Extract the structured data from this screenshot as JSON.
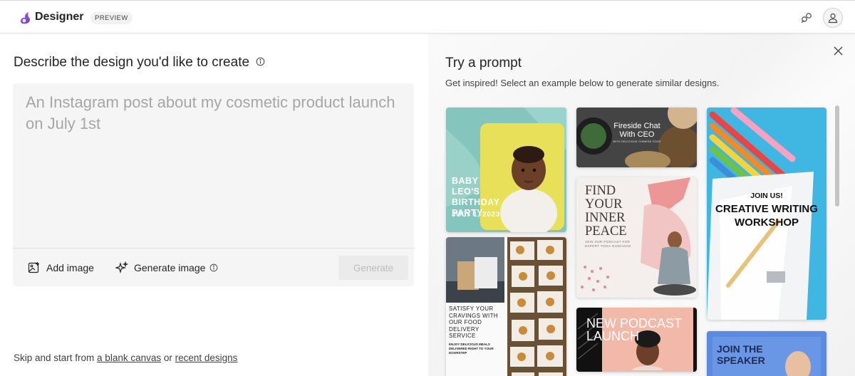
{
  "header": {
    "app_title": "Designer",
    "badge": "PREVIEW",
    "accent_color": "#8a4fd6"
  },
  "left": {
    "title": "Describe the design you'd like to create",
    "prompt_placeholder": "An Instagram post about my cosmetic product launch on July 1st",
    "add_image_label": "Add image",
    "generate_image_label": "Generate image",
    "generate_label": "Generate",
    "footer": {
      "prefix": "Skip and start from ",
      "blank_canvas_link": "a blank canvas",
      "middle": " or ",
      "recent_designs_link": "recent designs"
    }
  },
  "right": {
    "title": "Try a prompt",
    "subtitle": "Get inspired! Select an example below to generate similar designs.",
    "cards": {
      "birthday": {
        "title": "BABY LEO'S BIRTHDAY PARTY",
        "date": "JULY 1, 2023"
      },
      "fireside": {
        "title": "Fireside Chat With CEO",
        "subtitle": "WITH DELICIOUS CHINESE FOOD"
      },
      "peace": {
        "title": "FIND YOUR INNER PEACE",
        "subtitle": "JOIN OUR PODCAST FOR EXPERT YOGA GUIDANCE"
      },
      "food": {
        "title": "SATISFY YOUR CRAVINGS WITH OUR FOOD DELIVERY SERVICE",
        "subtitle": "ENJOY DELICIOUS MEALS DELIVERED RIGHT TO YOUR DOORSTEP"
      },
      "podcast": {
        "title": "NEW PODCAST LAUNCH"
      },
      "workshop": {
        "label": "JOIN US!",
        "title": "CREATIVE WRITING WORKSHOP"
      },
      "speaker": {
        "title": "JOIN THE SPEAKER"
      }
    }
  },
  "icons": {
    "logo": "designer-logo-icon",
    "share": "share-icon",
    "account": "account-icon",
    "info": "info-icon",
    "add_image": "image-add-icon",
    "generate_image": "sparkle-icon",
    "close": "close-icon"
  }
}
